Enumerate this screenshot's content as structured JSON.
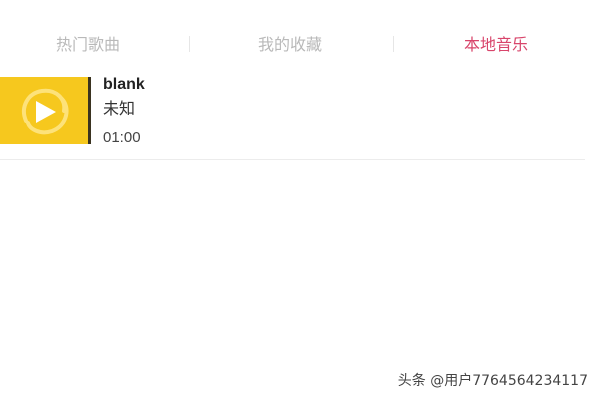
{
  "tabs": {
    "hot": "热门歌曲",
    "favorites": "我的收藏",
    "local": "本地音乐",
    "active": "local",
    "active_color": "#d8456b",
    "inactive_color": "#b9b9b9"
  },
  "song": {
    "title": "blank",
    "artist": "未知",
    "duration": "01:00",
    "cover_color": "#f6c81e",
    "cover_icon": "play-icon"
  },
  "watermark": "头条 @用户7764564234117"
}
